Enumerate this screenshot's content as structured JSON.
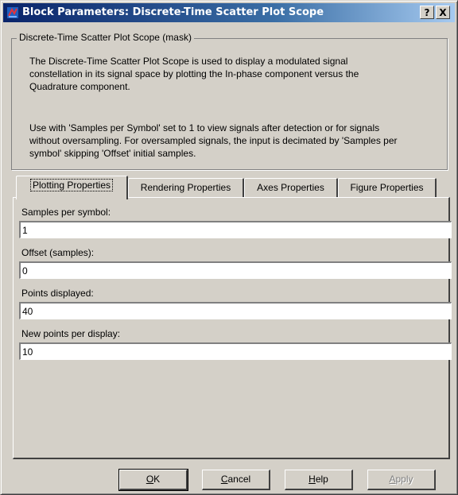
{
  "window": {
    "title": "Block Parameters: Discrete-Time Scatter Plot Scope",
    "help_button": "?",
    "close_button": "X"
  },
  "mask": {
    "group_label": "Discrete-Time Scatter Plot Scope (mask)",
    "description_1": [
      "The Discrete-Time Scatter Plot Scope is used to display a modulated signal",
      "constellation in its signal space by plotting the In-phase component versus the",
      "Quadrature component."
    ],
    "description_2": [
      "Use with 'Samples per Symbol' set to 1 to view signals after detection or for signals",
      "without oversampling.  For oversampled signals, the input is decimated by 'Samples per",
      "symbol' skipping 'Offset' initial samples."
    ]
  },
  "tabs": [
    {
      "label": "Plotting Properties",
      "active": true
    },
    {
      "label": "Rendering Properties",
      "active": false
    },
    {
      "label": "Axes Properties",
      "active": false
    },
    {
      "label": "Figure Properties",
      "active": false
    }
  ],
  "fields": [
    {
      "label": "Samples per symbol:",
      "value": "1"
    },
    {
      "label": "Offset (samples):",
      "value": "0"
    },
    {
      "label": "Points displayed:",
      "value": "40"
    },
    {
      "label": "New points per display:",
      "value": "10"
    }
  ],
  "buttons": {
    "ok": {
      "prefix": "",
      "accel": "O",
      "rest": "K"
    },
    "cancel": {
      "prefix": "",
      "accel": "C",
      "rest": "ancel"
    },
    "help": {
      "prefix": "",
      "accel": "H",
      "rest": "elp"
    },
    "apply": {
      "prefix": "",
      "accel": "A",
      "rest": "pply",
      "enabled": false
    }
  },
  "colors": {
    "titlebar_start": "#0a246a",
    "titlebar_end": "#a6caf0",
    "face": "#d4d0c8"
  },
  "icons": {
    "app": "simulink-block-icon",
    "help": "help-icon",
    "close": "close-icon"
  }
}
